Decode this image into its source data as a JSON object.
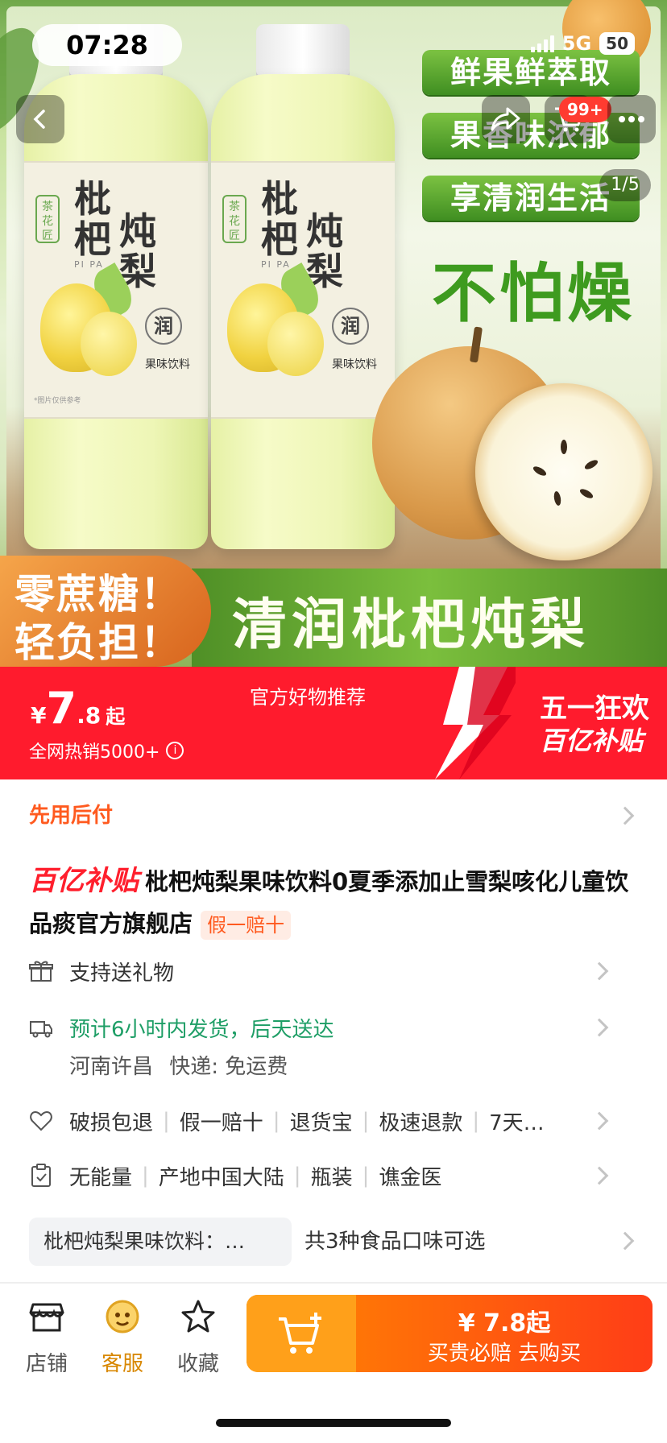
{
  "status_bar": {
    "time": "07:28",
    "network": "5G",
    "battery": "50"
  },
  "hero": {
    "cart_badge": "99+",
    "image_counter": "1/5",
    "pills": [
      "鲜果鲜萃取",
      "果香味浓郁",
      "享清润生活"
    ],
    "slogan": "不怕燥",
    "bottle": {
      "brand": "茶花匠",
      "name_line1": "枇杷",
      "name_line2": "炖梨",
      "pinyin": "PI PA",
      "run": "润",
      "kind": "果味饮料",
      "note": "*图片仅供参考"
    },
    "promo_left": [
      "零蔗糖！",
      "轻负担！"
    ],
    "promo_right": "清润枇杷炖梨"
  },
  "price_banner": {
    "yen": "¥",
    "price_int": "7",
    "price_dec": ".8",
    "price_suffix": "起",
    "hot_sales": "全网热销5000+",
    "recommend": "官方好物推荐",
    "festival_title": "五一狂欢",
    "festival_sub": "百亿补贴"
  },
  "pay_later": "先用后付",
  "product": {
    "subsidy_logo": "百亿补贴",
    "title": "枇杷炖梨果味饮料0夏季添加止雪梨咳化儿童饮品痰官方旗舰店",
    "tag": "假一赔十"
  },
  "services": {
    "gift": "支持送礼物",
    "shipping": "预计6小时内发货，后天送达",
    "ship_from": "河南许昌",
    "express": "快递: 免运费",
    "guarantees": [
      "破损包退",
      "假一赔十",
      "退货宝",
      "极速退款",
      "7天…"
    ],
    "attributes": [
      "无能量",
      "产地中国大陆",
      "瓶装",
      "谯金医"
    ]
  },
  "flavor": {
    "selected": "枇杷炖梨果味饮料：…",
    "count": "共3种食品口味可选"
  },
  "bottom_bar": {
    "store": "店铺",
    "service": "客服",
    "favorite": "收藏",
    "buy_price": "¥ 7.8起",
    "buy_text": "买贵必赔  去购买"
  },
  "colors": {
    "accent_red": "#ff1b2d",
    "accent_orange": "#ff5a1f",
    "green": "#1e9e66",
    "gold": "#d88700"
  }
}
